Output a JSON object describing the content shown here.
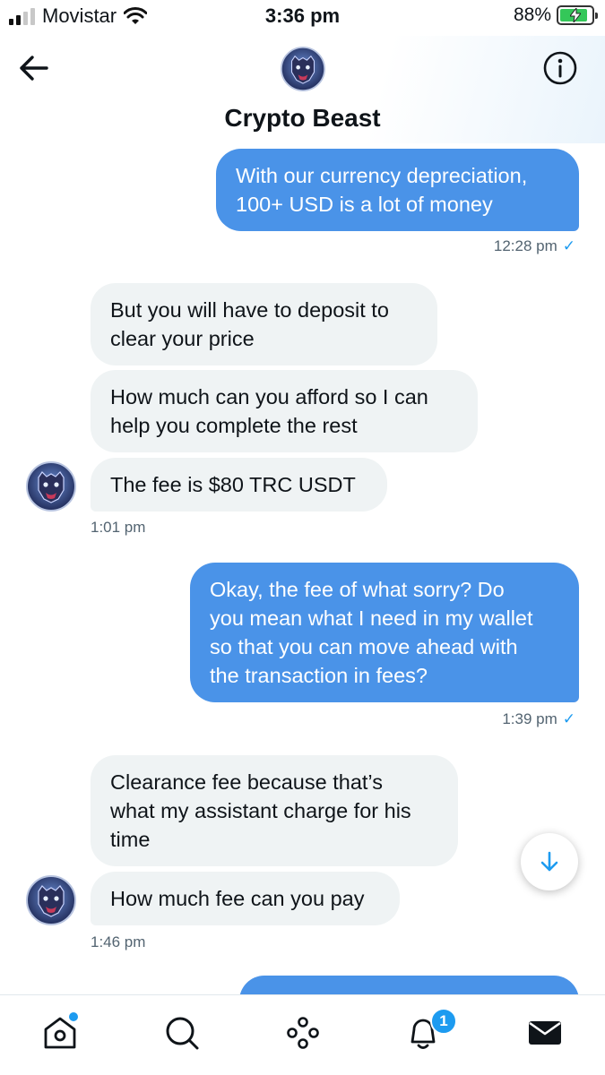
{
  "status_bar": {
    "carrier": "Movistar",
    "time": "3:36 pm",
    "battery": "88%",
    "battery_level": 0.88,
    "battery_color": "#34c759"
  },
  "header": {
    "title": "Crypto Beast",
    "back_icon": "arrow-left-icon",
    "info_icon": "info-circle-icon",
    "avatar": "bear-avatar"
  },
  "messages": [
    {
      "direction": "out",
      "text": "With our currency depreciation,\n100+ USD is a lot of money"
    },
    {
      "direction": "out_meta",
      "time": "12:28 pm",
      "read": "✓"
    },
    {
      "direction": "in",
      "text": "But you will have to deposit to\nclear your price"
    },
    {
      "direction": "in",
      "text": "How much can you afford so I can\nhelp you complete the rest"
    },
    {
      "direction": "in",
      "text": "The fee is $80 TRC USDT"
    },
    {
      "direction": "in_meta",
      "time": "1:01 pm"
    },
    {
      "direction": "out",
      "text": "Okay, the fee of what sorry? Do\nyou mean what I need in my wallet\nso that you can move ahead with\nthe transaction in fees?"
    },
    {
      "direction": "out_meta",
      "time": "1:39 pm",
      "read": "✓"
    },
    {
      "direction": "in",
      "text": "Clearance fee because that’s\nwhat my assistant charge for his\ntime"
    },
    {
      "direction": "in",
      "text": "How much fee can you pay"
    },
    {
      "direction": "in_meta",
      "time": "1:46 pm"
    }
  ],
  "scroll_down": {
    "icon": "arrow-down-icon"
  },
  "tab_bar": {
    "items": [
      "home-icon",
      "search-icon",
      "spaces-icon",
      "notifications-icon",
      "messages-icon"
    ],
    "notifications_badge": "1"
  },
  "colors": {
    "accent": "#1d9bf0",
    "outgoing_bubble": "#4a93e8",
    "incoming_bubble": "#eff3f4"
  }
}
